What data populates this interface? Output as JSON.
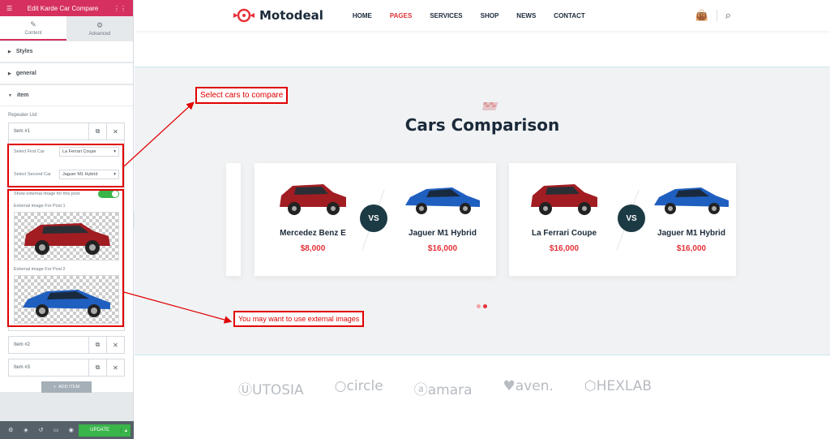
{
  "editor": {
    "title": "Edit Karde Car Compare",
    "tabs": [
      "Content",
      "Advanced"
    ],
    "sections": {
      "styles": "Styles",
      "general": "general",
      "item": "item"
    },
    "repeater_label": "Repeater List",
    "items": [
      "Item #1",
      "Item #2",
      "Item #3"
    ],
    "first_car_label": "Select First Car",
    "first_car_value": "La Ferrari Coupe",
    "second_car_label": "Select Second Car",
    "second_car_value": "Jaguer M1 Hybrid",
    "external_toggle_label": "Show external image for this post",
    "ext_img1_label": "External image For Post 1",
    "ext_img2_label": "External image For Post 2",
    "add_item": "ADD ITEM",
    "update": "UPDATE"
  },
  "site": {
    "logo": "Motodeal",
    "nav": [
      "HOME",
      "PAGES",
      "SERVICES",
      "SHOP",
      "NEWS",
      "CONTACT"
    ],
    "active_nav": "PAGES",
    "section_title": "Cars Comparison",
    "vs": "VS",
    "cards": [
      {
        "left_name": "Mercedez Benz E",
        "left_price": "$8,000",
        "right_name": "Jaguer M1 Hybrid",
        "right_price": "$16,000"
      },
      {
        "left_name": "La Ferrari Coupe",
        "left_price": "$16,000",
        "right_name": "Jaguer M1 Hybrid",
        "right_price": "$16,000"
      }
    ],
    "brands": [
      "UTOSIA",
      "circle",
      "amara",
      "aven.",
      "HEXLAB"
    ]
  },
  "annotations": {
    "select_cars": "Select cars to compare",
    "external_images": "You may want to use external images"
  },
  "colors": {
    "accent": "#e53238",
    "editor_brand": "#d6305e",
    "vs_circle": "#1c3a44",
    "annotation": "#e00000",
    "update_green": "#39b54a"
  },
  "icons": {
    "red_car": "red-suv-image",
    "blue_car": "blue-sedan-image"
  }
}
